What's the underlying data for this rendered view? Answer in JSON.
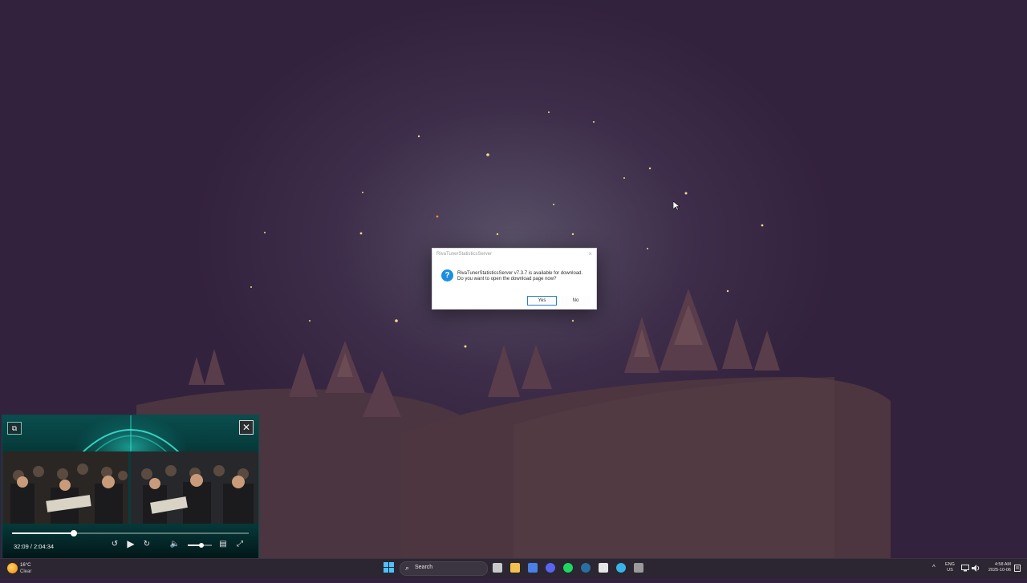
{
  "dialog": {
    "title": "RivaTunerStatisticsServer",
    "message": "RivaTunerStatisticsServer v7.3.7 is available for download. Do you want to open the download page now?",
    "yes_label": "Yes",
    "no_label": "No",
    "icon": "question-icon",
    "close_glyph": "×"
  },
  "player": {
    "time": "32:09 / 2:04:34",
    "progress": 0.26,
    "volume": 0.55,
    "icons": [
      "picture-in-picture-icon",
      "close-icon",
      "rewind-10-icon",
      "play-icon",
      "forward-10-icon",
      "volume-icon",
      "captions-icon",
      "expand-icon"
    ],
    "close_glyph": "✕",
    "pip_glyph": "⧉",
    "play_glyph": "▶",
    "rewind_glyph": "↺",
    "forward_glyph": "↻",
    "volume_glyph": "🔈",
    "captions_glyph": "▤",
    "expand_glyph": "⤢"
  },
  "taskbar": {
    "weather": {
      "temp": "16°C",
      "condition": "Clear"
    },
    "search_placeholder": "Search",
    "search_glyph": "⌕",
    "apps": [
      {
        "name": "task-view",
        "color": "#c9c9c9"
      },
      {
        "name": "file-explorer",
        "color": "#f2c14e"
      },
      {
        "name": "app-blue",
        "color": "#4a7fe6"
      },
      {
        "name": "discord",
        "color": "#5865f2"
      },
      {
        "name": "spotify",
        "color": "#1ed760"
      },
      {
        "name": "steam",
        "color": "#2a6fa3"
      },
      {
        "name": "app-grid",
        "color": "#e6e6e6"
      },
      {
        "name": "browser",
        "color": "#37b5e8"
      },
      {
        "name": "app-gray",
        "color": "#9a9a9a"
      }
    ],
    "tray_chevron": "^",
    "language": "ENG",
    "region": "US",
    "time": "4:58 AM",
    "date": "2025-10-06"
  },
  "colors": {
    "wallpaper": "#33223d",
    "taskbar": "#2b2631",
    "accent": "#1a8fe3",
    "player_bg": "#082e30"
  }
}
